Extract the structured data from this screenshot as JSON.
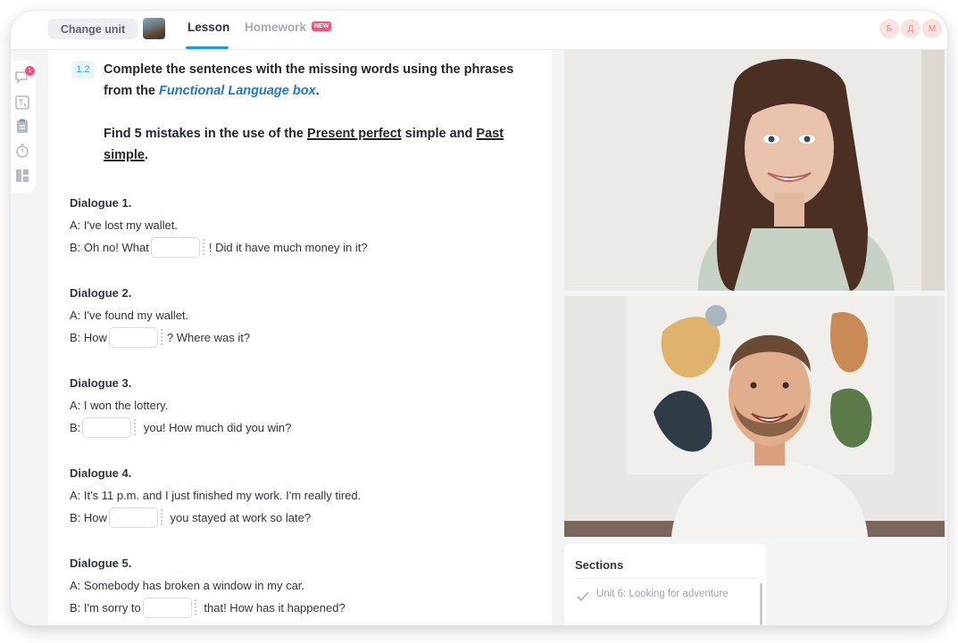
{
  "topbar": {
    "change_unit_label": "Change unit",
    "tabs": [
      {
        "label": "Lesson",
        "active": true
      },
      {
        "label": "Homework",
        "active": false,
        "badge": "NEW"
      }
    ],
    "participants": [
      "Б",
      "Д",
      "М"
    ]
  },
  "rail": {
    "items": [
      {
        "icon": "chat-icon",
        "badge": "1"
      },
      {
        "icon": "translate-icon"
      },
      {
        "icon": "clipboard-icon"
      },
      {
        "icon": "timer-icon"
      },
      {
        "icon": "layout-icon"
      }
    ]
  },
  "task": {
    "number": "1.2",
    "instruction_part1": "Complete the sentences with the missing words using the phrases from the ",
    "instruction_link": "Functional Language box",
    "instruction_end": ".",
    "mistakes_part1": "Find 5 mistakes in the use of the ",
    "mistakes_u1": "Present perfect",
    "mistakes_part2": " simple and ",
    "mistakes_u2": "Past simple",
    "mistakes_end": "."
  },
  "dialogues": [
    {
      "title": "Dialogue 1.",
      "line_a": "A: I've lost my wallet.",
      "line_b_before": "B: Oh no! What",
      "line_b_after": "! Did it have much money in it?"
    },
    {
      "title": "Dialogue 2.",
      "line_a": "A: I've found my wallet.",
      "line_b_before": "B: How",
      "line_b_after": "? Where was it?"
    },
    {
      "title": "Dialogue 3.",
      "line_a": "A: I won the lottery.",
      "line_b_before": "B:",
      "line_b_after": " you! How much did you win?"
    },
    {
      "title": "Dialogue 4.",
      "line_a": "A: It's 11 p.m. and I just finished my work. I'm really tired.",
      "line_b_before": "B: How",
      "line_b_after": " you stayed at work so late?"
    },
    {
      "title": "Dialogue 5.",
      "line_a": "A: Somebody has broken a window in my car.",
      "line_b_before": "B: I'm sorry to",
      "line_b_after": " that! How has it happened?"
    }
  ],
  "sections": {
    "title": "Sections",
    "items": [
      {
        "label": "Unit 6: Looking for adventure",
        "done": true
      }
    ]
  },
  "colors": {
    "accent": "#1b9be0",
    "link": "#1f78d1",
    "badge": "#f0567e"
  }
}
